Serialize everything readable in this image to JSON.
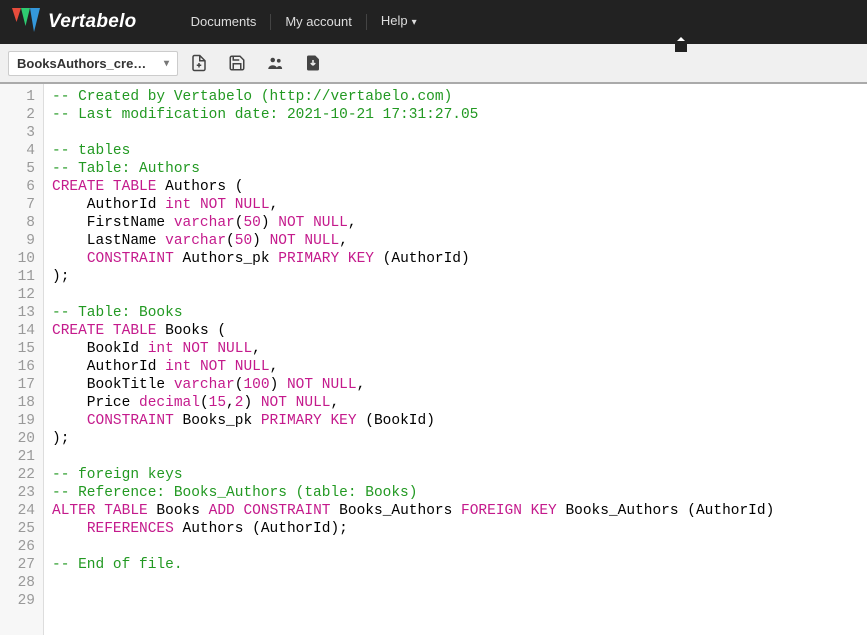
{
  "brand": "Vertabelo",
  "nav": {
    "documents": "Documents",
    "myaccount": "My account",
    "help": "Help"
  },
  "toolbar": {
    "document_name": "BooksAuthors_cre…"
  },
  "code": {
    "lines": [
      [
        {
          "t": "-- Created by Vertabelo (http://vertabelo.com)",
          "c": "cm"
        }
      ],
      [
        {
          "t": "-- Last modification date: 2021-10-21 17:31:27.05",
          "c": "cm"
        }
      ],
      [],
      [
        {
          "t": "-- tables",
          "c": "cm"
        }
      ],
      [
        {
          "t": "-- Table: Authors",
          "c": "cm"
        }
      ],
      [
        {
          "t": "CREATE",
          "c": "kw"
        },
        {
          "t": " "
        },
        {
          "t": "TABLE",
          "c": "kw"
        },
        {
          "t": " Authors ("
        }
      ],
      [
        {
          "t": "    AuthorId "
        },
        {
          "t": "int",
          "c": "ty"
        },
        {
          "t": " "
        },
        {
          "t": "NOT",
          "c": "nn"
        },
        {
          "t": " "
        },
        {
          "t": "NULL",
          "c": "nn"
        },
        {
          "t": ","
        }
      ],
      [
        {
          "t": "    FirstName "
        },
        {
          "t": "varchar",
          "c": "ty"
        },
        {
          "t": "("
        },
        {
          "t": "50",
          "c": "num"
        },
        {
          "t": ") "
        },
        {
          "t": "NOT",
          "c": "nn"
        },
        {
          "t": " "
        },
        {
          "t": "NULL",
          "c": "nn"
        },
        {
          "t": ","
        }
      ],
      [
        {
          "t": "    LastName "
        },
        {
          "t": "varchar",
          "c": "ty"
        },
        {
          "t": "("
        },
        {
          "t": "50",
          "c": "num"
        },
        {
          "t": ") "
        },
        {
          "t": "NOT",
          "c": "nn"
        },
        {
          "t": " "
        },
        {
          "t": "NULL",
          "c": "nn"
        },
        {
          "t": ","
        }
      ],
      [
        {
          "t": "    "
        },
        {
          "t": "CONSTRAINT",
          "c": "kw"
        },
        {
          "t": " Authors_pk "
        },
        {
          "t": "PRIMARY",
          "c": "kw"
        },
        {
          "t": " "
        },
        {
          "t": "KEY",
          "c": "kw"
        },
        {
          "t": " (AuthorId)"
        }
      ],
      [
        {
          "t": ");"
        }
      ],
      [],
      [
        {
          "t": "-- Table: Books",
          "c": "cm"
        }
      ],
      [
        {
          "t": "CREATE",
          "c": "kw"
        },
        {
          "t": " "
        },
        {
          "t": "TABLE",
          "c": "kw"
        },
        {
          "t": " Books ("
        }
      ],
      [
        {
          "t": "    BookId "
        },
        {
          "t": "int",
          "c": "ty"
        },
        {
          "t": " "
        },
        {
          "t": "NOT",
          "c": "nn"
        },
        {
          "t": " "
        },
        {
          "t": "NULL",
          "c": "nn"
        },
        {
          "t": ","
        }
      ],
      [
        {
          "t": "    AuthorId "
        },
        {
          "t": "int",
          "c": "ty"
        },
        {
          "t": " "
        },
        {
          "t": "NOT",
          "c": "nn"
        },
        {
          "t": " "
        },
        {
          "t": "NULL",
          "c": "nn"
        },
        {
          "t": ","
        }
      ],
      [
        {
          "t": "    BookTitle "
        },
        {
          "t": "varchar",
          "c": "ty"
        },
        {
          "t": "("
        },
        {
          "t": "100",
          "c": "num"
        },
        {
          "t": ") "
        },
        {
          "t": "NOT",
          "c": "nn"
        },
        {
          "t": " "
        },
        {
          "t": "NULL",
          "c": "nn"
        },
        {
          "t": ","
        }
      ],
      [
        {
          "t": "    Price "
        },
        {
          "t": "decimal",
          "c": "ty"
        },
        {
          "t": "("
        },
        {
          "t": "15",
          "c": "num"
        },
        {
          "t": ","
        },
        {
          "t": "2",
          "c": "num"
        },
        {
          "t": ") "
        },
        {
          "t": "NOT",
          "c": "nn"
        },
        {
          "t": " "
        },
        {
          "t": "NULL",
          "c": "nn"
        },
        {
          "t": ","
        }
      ],
      [
        {
          "t": "    "
        },
        {
          "t": "CONSTRAINT",
          "c": "kw"
        },
        {
          "t": " Books_pk "
        },
        {
          "t": "PRIMARY",
          "c": "kw"
        },
        {
          "t": " "
        },
        {
          "t": "KEY",
          "c": "kw"
        },
        {
          "t": " (BookId)"
        }
      ],
      [
        {
          "t": ");"
        }
      ],
      [],
      [
        {
          "t": "-- foreign keys",
          "c": "cm"
        }
      ],
      [
        {
          "t": "-- Reference: Books_Authors (table: Books)",
          "c": "cm"
        }
      ],
      [
        {
          "t": "ALTER",
          "c": "kw"
        },
        {
          "t": " "
        },
        {
          "t": "TABLE",
          "c": "kw"
        },
        {
          "t": " Books "
        },
        {
          "t": "ADD",
          "c": "kw"
        },
        {
          "t": " "
        },
        {
          "t": "CONSTRAINT",
          "c": "kw"
        },
        {
          "t": " Books_Authors "
        },
        {
          "t": "FOREIGN",
          "c": "kw"
        },
        {
          "t": " "
        },
        {
          "t": "KEY",
          "c": "kw"
        },
        {
          "t": " Books_Authors (AuthorId)"
        }
      ],
      [
        {
          "t": "    "
        },
        {
          "t": "REFERENCES",
          "c": "kw"
        },
        {
          "t": " Authors (AuthorId);"
        }
      ],
      [],
      [
        {
          "t": "-- End of file.",
          "c": "cm"
        }
      ],
      [],
      []
    ]
  }
}
